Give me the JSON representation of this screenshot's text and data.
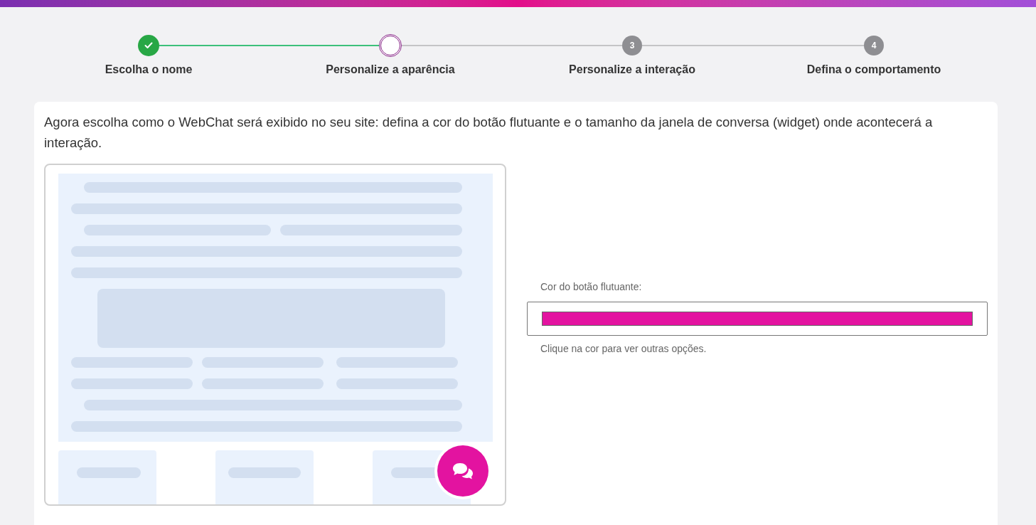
{
  "steps": [
    {
      "label": "Escolha o nome",
      "kind": "done"
    },
    {
      "label": "Personalize a aparência",
      "kind": "current"
    },
    {
      "label": "Personalize a interação",
      "kind": "pending",
      "number": "3"
    },
    {
      "label": "Defina o comportamento",
      "kind": "pending",
      "number": "4"
    }
  ],
  "intro": "Agora escolha como o WebChat será exibido no seu site: defina a cor do botão flutuante e o tamanho da janela de conversa (widget) onde acontecerá a interação.",
  "color_picker": {
    "label": "Cor do botão flutuante:",
    "color": "#e313a0",
    "hint": "Clique na cor para ver outras opções."
  }
}
